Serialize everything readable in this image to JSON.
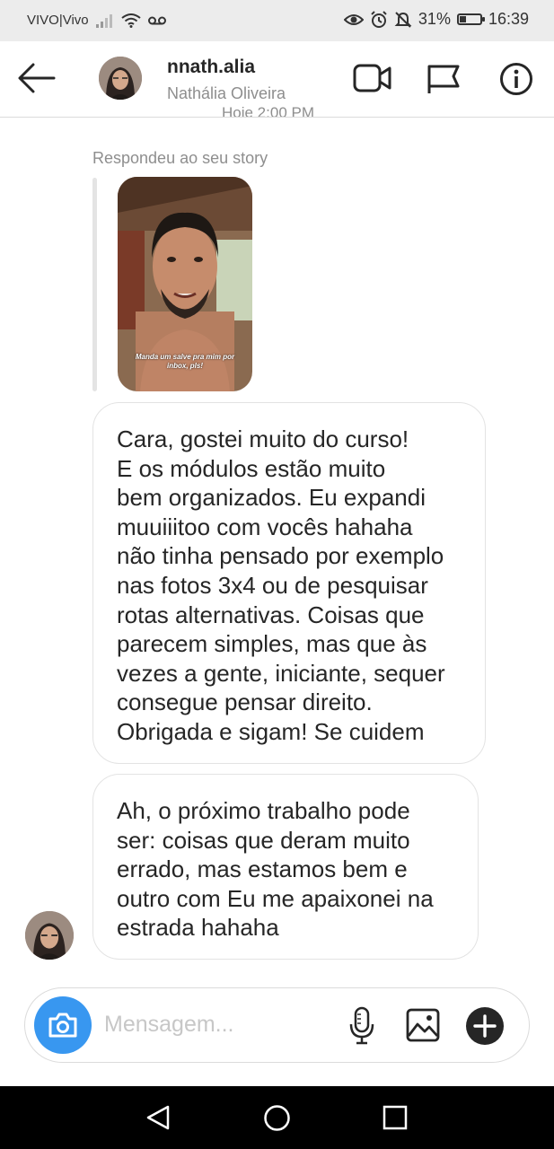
{
  "status_bar": {
    "carrier": "VIVO|Vivo",
    "battery_percent": "31%",
    "battery_level": 0.31,
    "time": "16:39"
  },
  "header": {
    "username": "nnath.alia",
    "full_name": "Nathália Oliveira"
  },
  "chat": {
    "timestamp_peek": "Hoje 2:00 PM",
    "story_reply_label": "Respondeu ao seu story",
    "story_caption": "Manda um salve pra mim por inbox, pls!",
    "messages": [
      {
        "lines": [
          "Cara, gostei muito do curso!",
          "E os módulos estão muito",
          "bem organizados. Eu expandi",
          "muuiiitoo com vocês hahaha",
          "não tinha pensado por exemplo",
          "nas fotos 3x4 ou de pesquisar",
          "rotas alternativas. Coisas que",
          "parecem simples, mas que às",
          "vezes a gente, iniciante, sequer",
          "consegue pensar direito.",
          "Obrigada e sigam! Se cuidem"
        ]
      },
      {
        "lines": [
          "Ah, o próximo trabalho pode",
          "ser: coisas que deram muito",
          "errado, mas estamos bem e",
          "outro com Eu me apaixonei na",
          "estrada hahaha"
        ]
      }
    ]
  },
  "composer": {
    "placeholder": "Mensagem..."
  },
  "colors": {
    "accent_blue": "#3897f0",
    "secondary_text": "#8e8e8e",
    "border": "#dbdbdb"
  },
  "icons": {
    "back": "arrow-left-icon",
    "video_call": "video-camera-icon",
    "flag": "flag-icon",
    "info": "info-icon",
    "camera": "camera-icon",
    "microphone": "microphone-icon",
    "gallery": "image-icon",
    "add": "plus-circle-icon"
  }
}
